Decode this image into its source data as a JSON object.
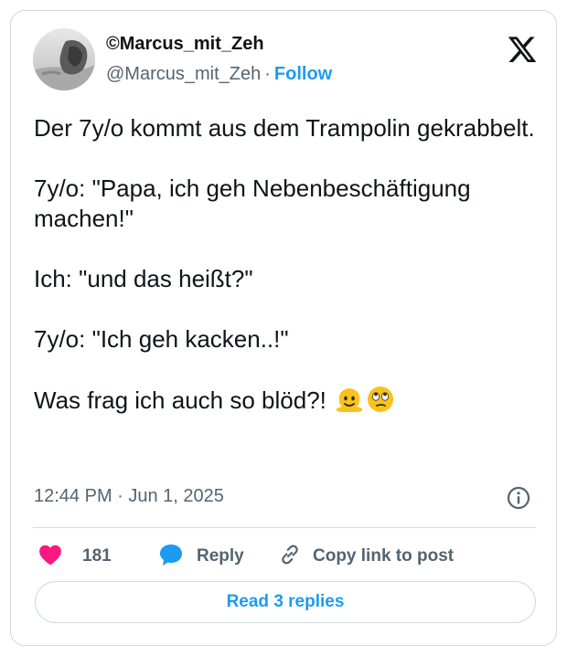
{
  "author": {
    "display_name": "©Marcus_mit_Zeh",
    "handle": "@Marcus_mit_Zeh",
    "separator": "·",
    "follow_label": "Follow"
  },
  "tweet": {
    "paragraphs": [
      "Der 7y/o kommt aus dem Trampolin gekrabbelt.",
      "7y/o: \"Papa, ich geh Nebenbeschäftigung machen!\"",
      "Ich: \"und das heißt?\"",
      "7y/o: \"Ich geh kacken..!\"",
      "Was frag ich auch so blöd?!"
    ],
    "emojis": [
      "melting-face",
      "face-with-rolling-eyes"
    ],
    "timestamp": "12:44 PM · Jun 1, 2025"
  },
  "actions": {
    "like_count": "181",
    "reply_label": "Reply",
    "copy_link_label": "Copy link to post"
  },
  "footer": {
    "read_replies_label": "Read 3 replies"
  },
  "colors": {
    "accent": "#1d9bf0",
    "like": "#f91880",
    "text": "#0f1419",
    "secondary": "#536471",
    "border": "#cfd9de"
  },
  "icons": [
    "x-logo-icon",
    "info-icon",
    "heart-icon",
    "reply-bubble-icon",
    "link-icon"
  ]
}
